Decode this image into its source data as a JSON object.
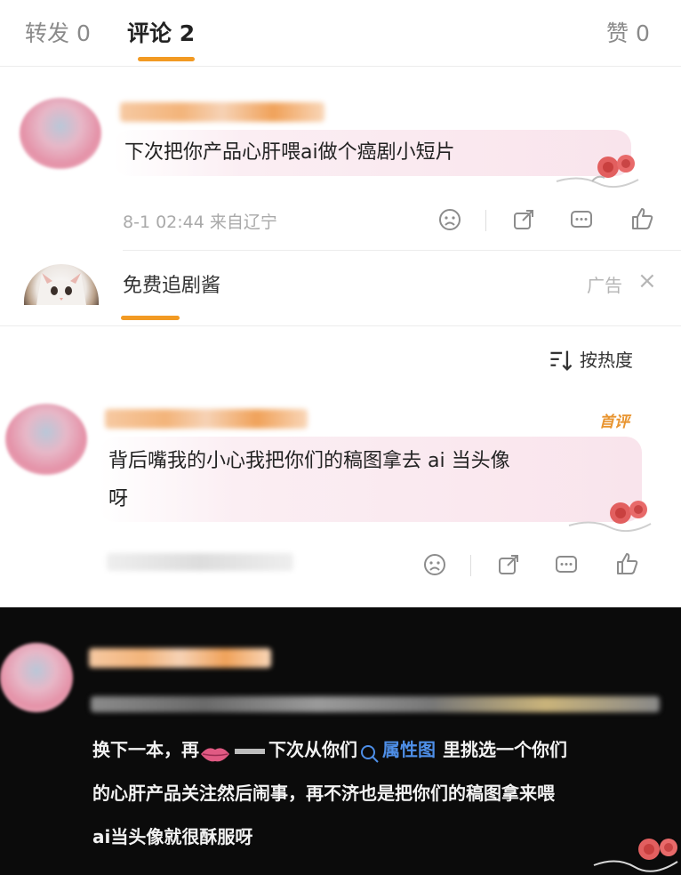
{
  "tabs": {
    "repost": "转发 0",
    "comments": "评论 2",
    "likes": "赞 0"
  },
  "comment1": {
    "text": "下次把你产品心肝喂ai做个癌剧小短片",
    "meta": "8-1 02:44 来自辽宁"
  },
  "ad": {
    "name": "免费追剧酱",
    "label": "广告",
    "close": "×"
  },
  "sort": {
    "label": "按热度"
  },
  "comment2": {
    "badge": "首评",
    "text_line1": "背后嘴我的小心我把你们的稿图拿去 ai 当头像",
    "text_line2": "呀"
  },
  "dark_post": {
    "seg1": "换下一本，再",
    "seg2": "下次从你们",
    "link": "属性图",
    "seg3": "里挑选一个你们",
    "line2": "的心肝产品关注然后闹事，再不济也是把你们的稿图拿来喂",
    "line3": "ai当头像就很酥服呀"
  },
  "colors": {
    "accent": "#f29a23",
    "link_blue": "#4e8fe8",
    "badge_orange": "#e8942f"
  }
}
